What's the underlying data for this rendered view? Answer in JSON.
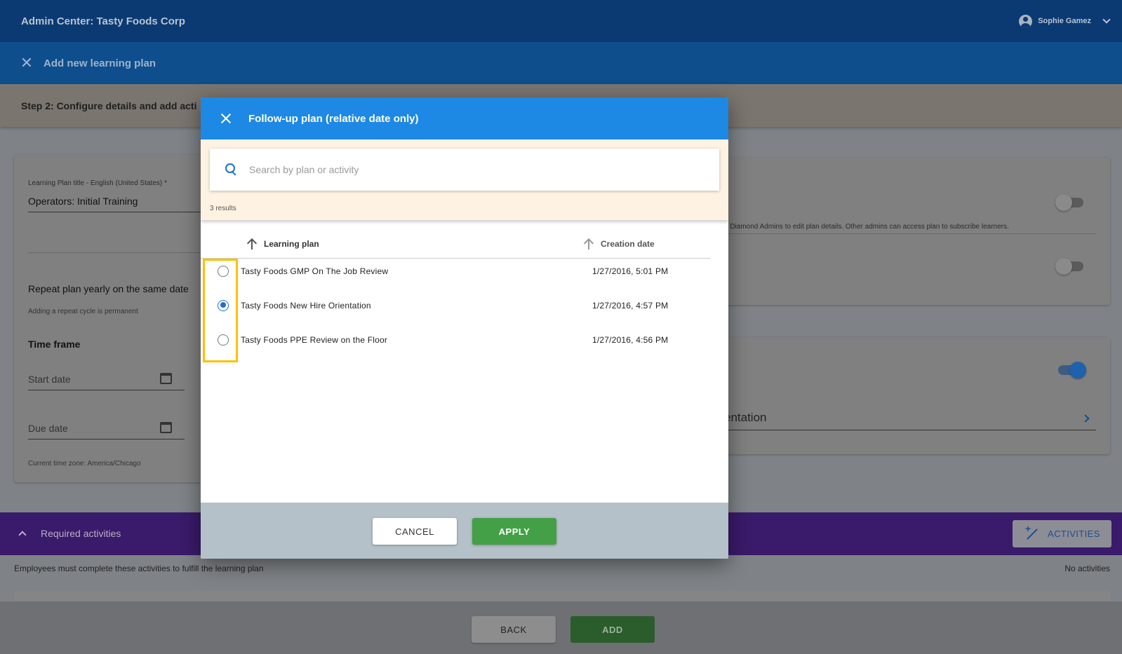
{
  "app": {
    "title": "Admin Center: Tasty Foods Corp",
    "user_name": "Sophie Gamez"
  },
  "subheader": {
    "title": "Add new learning plan"
  },
  "step": {
    "title": "Step 2: Configure details and add acti"
  },
  "form": {
    "title_label": "Learning Plan title - English (United States) *",
    "title_value": "Operators: Initial Training",
    "repeat_label": "Repeat plan yearly on the same date",
    "repeat_note": "Adding a repeat cycle is permanent",
    "timeframe_label": "Time frame",
    "start_date_placeholder": "Start date",
    "due_date_placeholder": "Due date",
    "timezone_text": "Current time zone: America/Chicago",
    "permission_text": "d Diamond Admins to edit plan details. Other admins can access plan to subscribe learners.",
    "followup_value": "entation"
  },
  "required": {
    "title": "Required activities",
    "activities_button": "ACTIVITIES",
    "description": "Employees must complete these activities to fulfill the learning plan",
    "no_activities": "No activities"
  },
  "footer": {
    "back_label": "BACK",
    "add_label": "ADD"
  },
  "modal": {
    "title": "Follow-up plan (relative date only)",
    "search_placeholder": "Search by plan or activity",
    "results_text": "3 results",
    "col_plan": "Learning plan",
    "col_date": "Creation date",
    "rows": [
      {
        "name": "Tasty Foods GMP On The Job Review",
        "date": "1/27/2016, 5:01 PM",
        "selected": false
      },
      {
        "name": "Tasty Foods New Hire Orientation",
        "date": "1/27/2016, 4:57 PM",
        "selected": true
      },
      {
        "name": "Tasty Foods PPE Review on the Floor",
        "date": "1/27/2016, 4:56 PM",
        "selected": false
      }
    ],
    "cancel_label": "CANCEL",
    "apply_label": "APPLY"
  },
  "colors": {
    "topbar": "#0b3a73",
    "modal_header": "#1e88e5",
    "search_area": "#fef3e2",
    "apply": "#43a047",
    "highlight": "#ffc000",
    "radio_selected": "#1e6fd0"
  },
  "icons": {
    "close": "close-icon",
    "search": "search-icon",
    "sort": "arrow-up-icon",
    "calendar": "calendar-icon",
    "user": "account-circle-icon",
    "activities": "activities-icon"
  }
}
